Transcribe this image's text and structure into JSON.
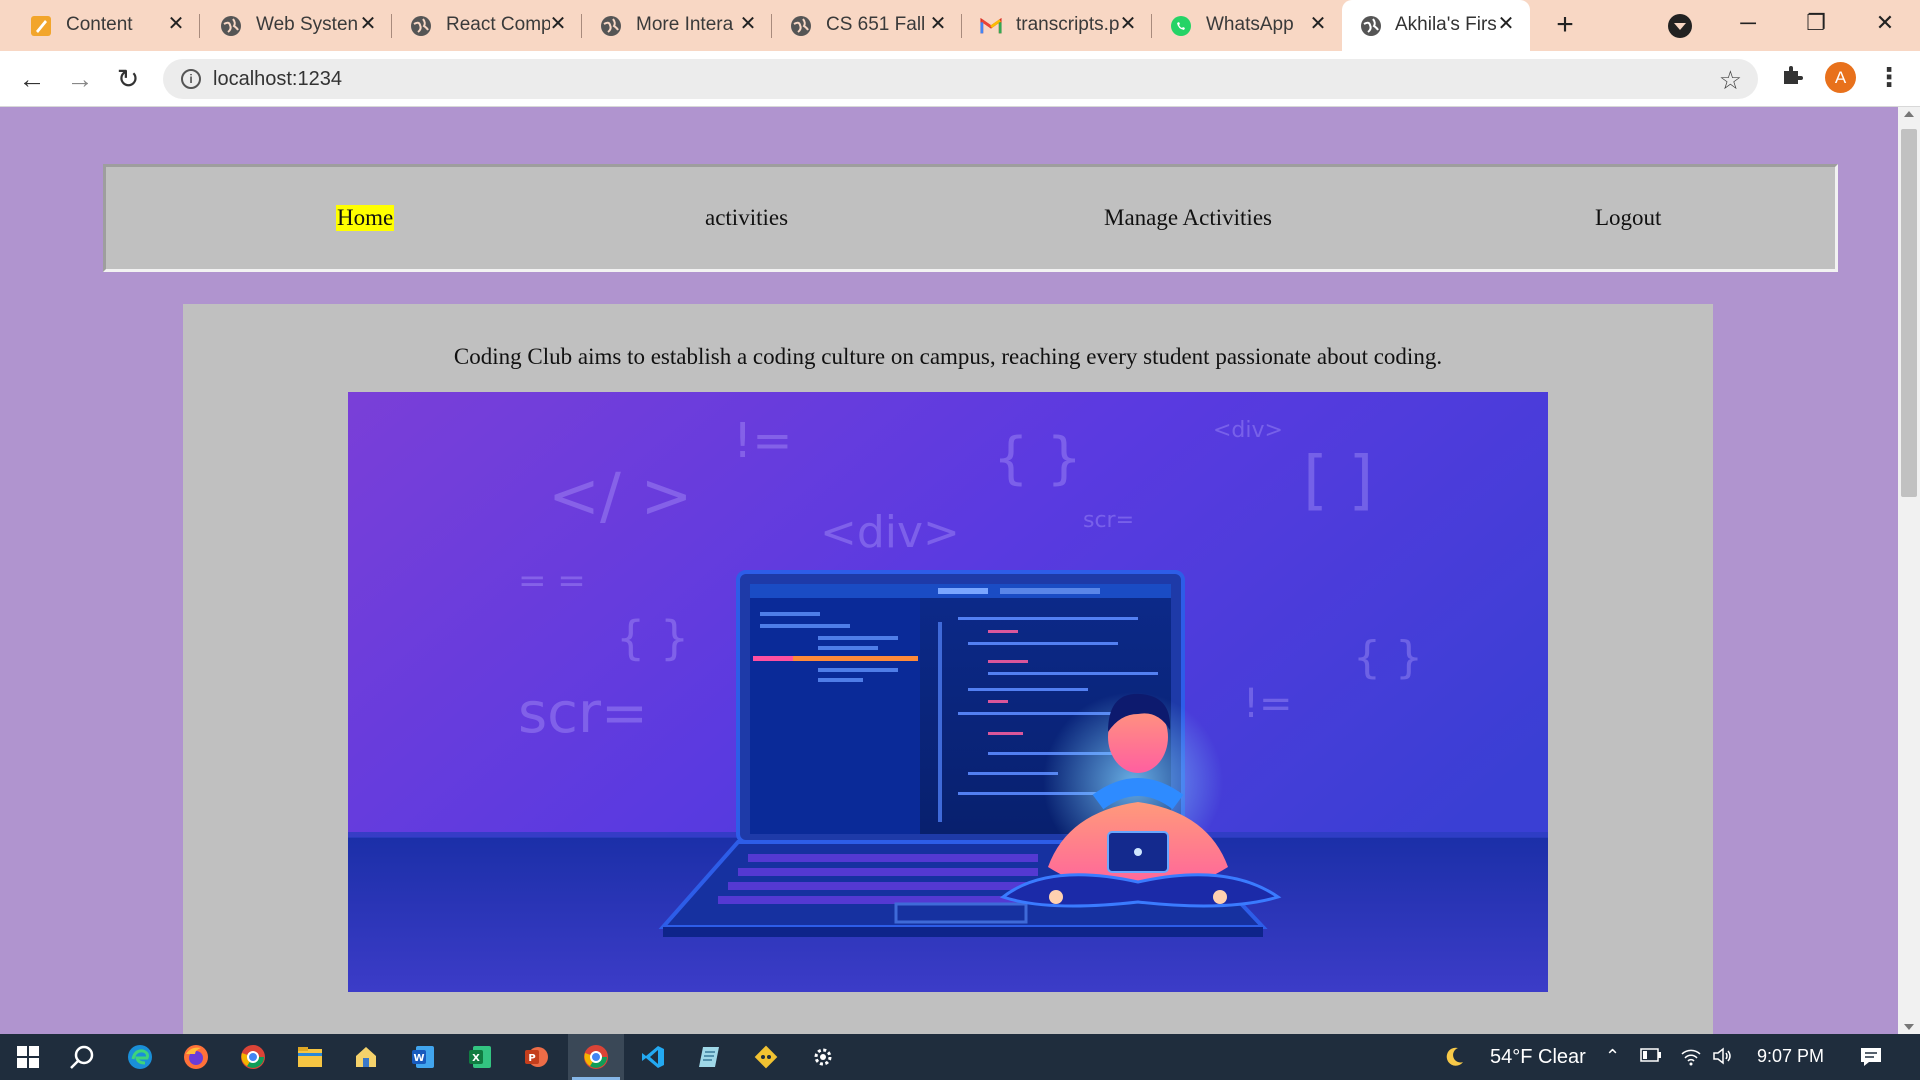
{
  "browser": {
    "tabs": [
      {
        "title": "Content",
        "icon": "notes-icon"
      },
      {
        "title": "Web Systen",
        "icon": "globe-icon"
      },
      {
        "title": "React Comp",
        "icon": "globe-icon"
      },
      {
        "title": "More Intera",
        "icon": "globe-icon"
      },
      {
        "title": "CS 651 Fall",
        "icon": "globe-icon"
      },
      {
        "title": "transcripts.p",
        "icon": "gmail-icon"
      },
      {
        "title": "WhatsApp",
        "icon": "whatsapp-icon"
      },
      {
        "title": "Akhila's Firs",
        "icon": "globe-icon",
        "active": true
      }
    ],
    "url": "localhost:1234",
    "profile_initial": "A"
  },
  "page": {
    "nav": {
      "home": "Home",
      "activities": "activities",
      "manage": "Manage Activities",
      "logout": "Logout"
    },
    "tagline": "Coding Club aims to establish a coding culture on campus, reaching every student passionate about coding.",
    "hero_symbols": {
      "s1": "</ >",
      "s2": "!=",
      "s3": "{ }",
      "s4": "<div>",
      "s5": "[ ]",
      "s6": "<div>",
      "s7": "scr=",
      "s8": "= =",
      "s9": "{ }",
      "s10": "scr=",
      "s11": "!=",
      "s12": "{ }"
    }
  },
  "taskbar": {
    "weather": "54°F  Clear",
    "time": "9:07 PM"
  },
  "colors": {
    "page_bg": "#b094cf",
    "panel_bg": "#c0c0c0",
    "home_highlight": "#ffff00",
    "tab_strip": "#f8d7c4",
    "taskbar": "#1f2d3d"
  }
}
